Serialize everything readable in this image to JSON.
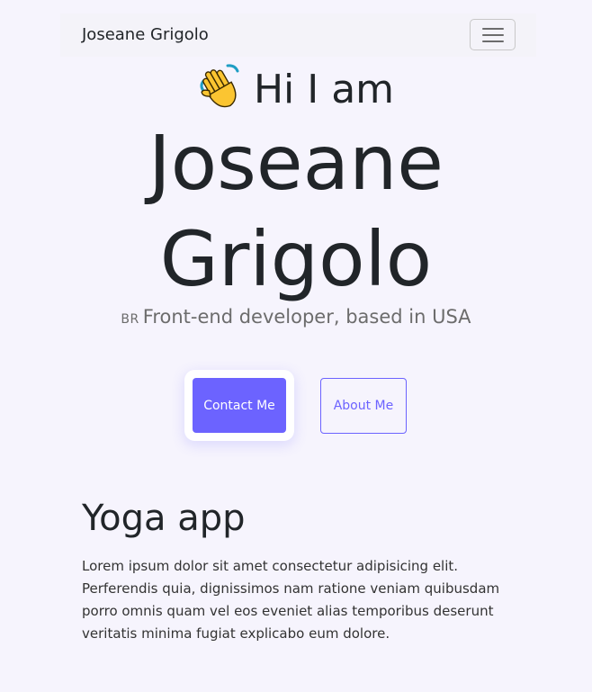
{
  "navbar": {
    "brand": "Joseane Grigolo",
    "toggler_icon": "hamburger-menu-icon"
  },
  "hero": {
    "wave_icon": "waving-hand-icon",
    "greeting": "Hi I am",
    "name_line1": "Joseane",
    "name_line2": "Grigolo",
    "country_code": "BR",
    "tagline": "Front-end developer, based in USA"
  },
  "buttons": {
    "contact": "Contact Me",
    "about": "About Me"
  },
  "project": {
    "title": "Yoga app",
    "description": "Lorem ipsum dolor sit amet consectetur adipisicing elit. Perferendis quia, dignissimos nam ratione veniam quibusdam porro omnis quam vel eos eveniet alias temporibus deserunt veritatis minima fugiat explicabo eum dolore."
  },
  "colors": {
    "accent": "#6c63ff",
    "background": "#f6f4fd",
    "text": "#212529",
    "muted": "#6c6c6c"
  }
}
